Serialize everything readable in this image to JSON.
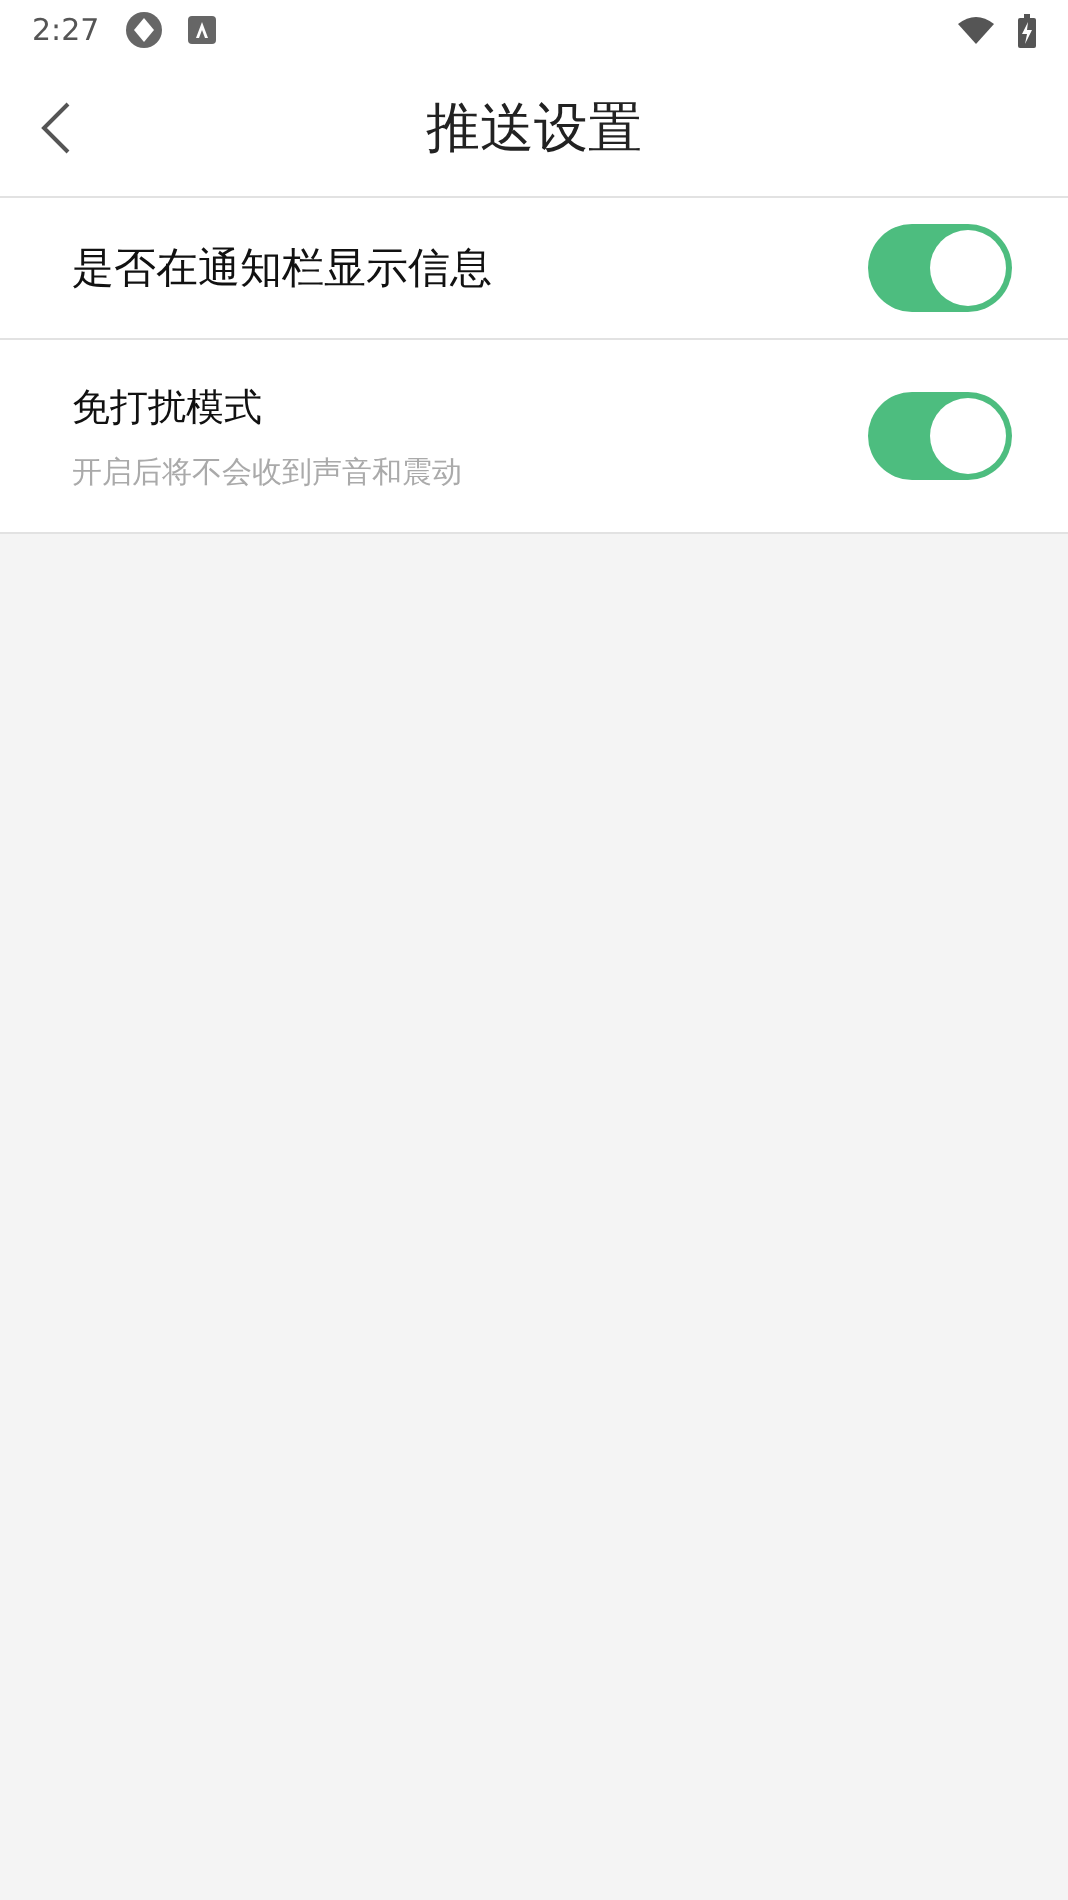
{
  "status_bar": {
    "time": "2:27"
  },
  "header": {
    "title": "推送设置"
  },
  "settings": [
    {
      "label": "是否在通知栏显示信息",
      "on": true
    },
    {
      "label": "免打扰模式",
      "description": "开启后将不会收到声音和震动",
      "on": true
    }
  ]
}
